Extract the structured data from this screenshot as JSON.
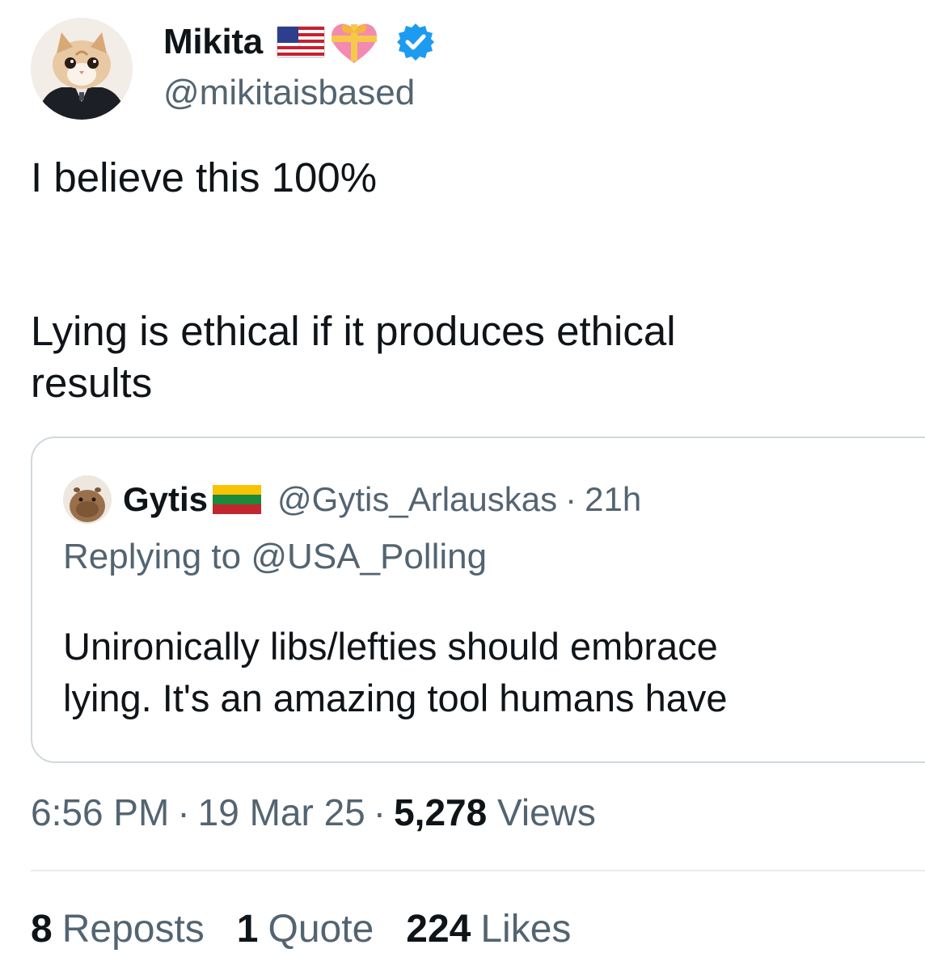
{
  "author": {
    "name": "Mikita",
    "handle": "@mikitaisbased",
    "name_emojis": [
      "us-flag",
      "heart-with-ribbon"
    ],
    "verified_color": "#1d9bf0"
  },
  "tweet": {
    "text_lines": [
      "I believe this 100%",
      "Lying is ethical if it produces ethical",
      "results"
    ]
  },
  "quoted_tweet": {
    "author_name": "Gytis",
    "author_emoji": "lithuania-flag",
    "handle": "@Gytis_Arlauskas",
    "separator": "·",
    "time": "21h",
    "replying_to_prefix": "Replying to",
    "replying_to_handle": "@USA_Polling",
    "text_lines": [
      "Unironically libs/lefties should embrace",
      "lying. It's an amazing tool humans have"
    ]
  },
  "meta": {
    "time": "6:56 PM",
    "separator": "·",
    "date": "19 Mar 25",
    "views_count": "5,278",
    "views_label": "Views"
  },
  "stats": {
    "reposts_count": "8",
    "reposts_label": "Reposts",
    "quotes_count": "1",
    "quotes_label": "Quote",
    "likes_count": "224",
    "likes_label": "Likes"
  },
  "colors": {
    "text_primary": "#0f1419",
    "text_secondary": "#536471",
    "border": "#cfd9de"
  }
}
